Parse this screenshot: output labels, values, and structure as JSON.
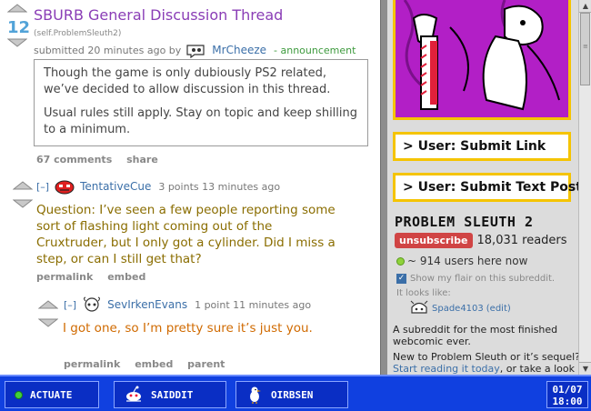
{
  "post": {
    "score": "12",
    "title": "SBURB General Discussion Thread",
    "domain": "(self.ProblemSleuth2)",
    "submitted": "submitted 20 minutes ago by",
    "author": "MrCheeze",
    "distinguish": "- announcement",
    "selftext": [
      "Though the game is only dubiously PS2 related, we’ve decided to allow discussion in this thread.",
      "Usual rules still apply. Stay on topic and keep shilling to a minimum."
    ],
    "buttons": {
      "comments": "67 comments",
      "share": "share"
    }
  },
  "comments": [
    {
      "toggle": "[–]",
      "author": "TentativeCue",
      "meta": "3 points 13 minutes ago",
      "body": "Question: I’ve seen a few people reporting some sort of flashing light coming out of the Cruxtruder, but I only got a cylinder. Did I miss a step, or can I still get that?",
      "color": "#8a6d00",
      "buttons": {
        "permalink": "permalink",
        "embed": "embed"
      }
    },
    {
      "toggle": "[–]",
      "author": "SevIrkenEvans",
      "meta": "1 point 11 minutes ago",
      "body": "I got one, so I’m pretty sure it’s just you.",
      "color": "#d06a00",
      "buttons": {
        "permalink": "permalink",
        "embed": "embed",
        "parent": "parent"
      }
    }
  ],
  "sidebar": {
    "submit_link": "> User: Submit Link",
    "submit_text": "> User: Submit Text Post",
    "subreddit_title": "PROBLEM SLEUTH 2",
    "unsubscribe": "unsubscribe",
    "readers": "18,031 readers",
    "online": "~ 914 users here now",
    "show_flair": "Show my flair on this subreddit.",
    "looks_like": "It looks like:",
    "flair_user": "Spade4103",
    "flair_edit": "(edit)",
    "description": "A subreddit for the most finished webcomic ever.",
    "new_prefix": "New to Problem Sleuth or it’s sequel?",
    "new_link": "Start reading it today",
    "new_suffix": ", or take a look"
  },
  "taskbar": {
    "actuate": "ACTUATE",
    "saiddit": "SAIDDIT",
    "oirbsen": "OIRBSEN",
    "date": "01/07",
    "time": "18:00"
  },
  "colors": {
    "title": "#8a3db6",
    "score": "#52a3d8",
    "link": "#3b6fa8",
    "banner_border": "#f5c400",
    "banner_bg": "#b21fc6",
    "taskbar": "#1040e0"
  }
}
